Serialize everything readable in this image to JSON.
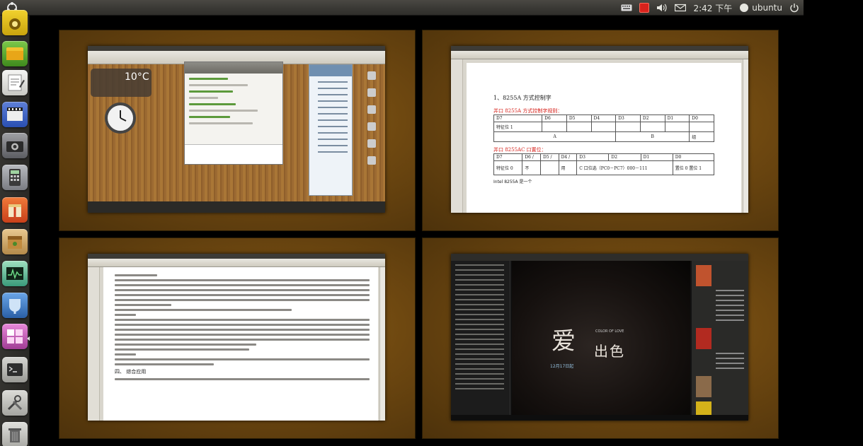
{
  "panel": {
    "time": "2:42 下午",
    "user": "ubuntu"
  },
  "launcher": {
    "items": [
      {
        "name": "ubuntu-software-center-icon"
      },
      {
        "name": "file-browser-icon"
      },
      {
        "name": "text-editor-icon"
      },
      {
        "name": "movie-player-icon"
      },
      {
        "name": "camera-icon"
      },
      {
        "name": "calculator-icon"
      },
      {
        "name": "gift-package-icon"
      },
      {
        "name": "archive-manager-icon"
      },
      {
        "name": "system-monitor-icon"
      },
      {
        "name": "wine-app-icon"
      },
      {
        "name": "workspace-switcher-icon"
      },
      {
        "name": "terminal-icon"
      },
      {
        "name": "tools-icon"
      },
      {
        "name": "trash-icon"
      }
    ]
  },
  "workspaces": {
    "ws1": {
      "weather_temp": "10°C"
    },
    "ws2": {
      "heading": "1、8255A 方式控制字",
      "subhead1": "并口 8255A 方式控制字规则：",
      "table1_row1": [
        "D7",
        "D6",
        "D5",
        "D4",
        "D3",
        "D2",
        "D1",
        "D0"
      ],
      "table1_row2": [
        "特征位 1",
        "",
        "",
        "",
        "",
        "",
        "",
        ""
      ],
      "table1_row3_mid": "A",
      "table1_row3_b": "B",
      "table1_row3_left": "组",
      "table1_row3_right": "组",
      "subhead2": "并口 8255AC 口置位：",
      "table2_row1": [
        "D7",
        "D6 /",
        "D5 /",
        "D4 /",
        "D3",
        "D2",
        "D1",
        "D0"
      ],
      "table2_row2": [
        "特征位 0",
        "不",
        "用",
        "C 口位选（PC0－PC7）000－111",
        "",
        "",
        "",
        "置位 0 置位 1"
      ],
      "footer": "Intel 8255A 是一个"
    },
    "ws3": {
      "section": "四、 综合应用"
    },
    "ws4": {
      "video_title": "爱",
      "video_title2": "出色",
      "video_sub1": "COLOR OF LOVE",
      "video_sub2": "12月17日起"
    }
  }
}
